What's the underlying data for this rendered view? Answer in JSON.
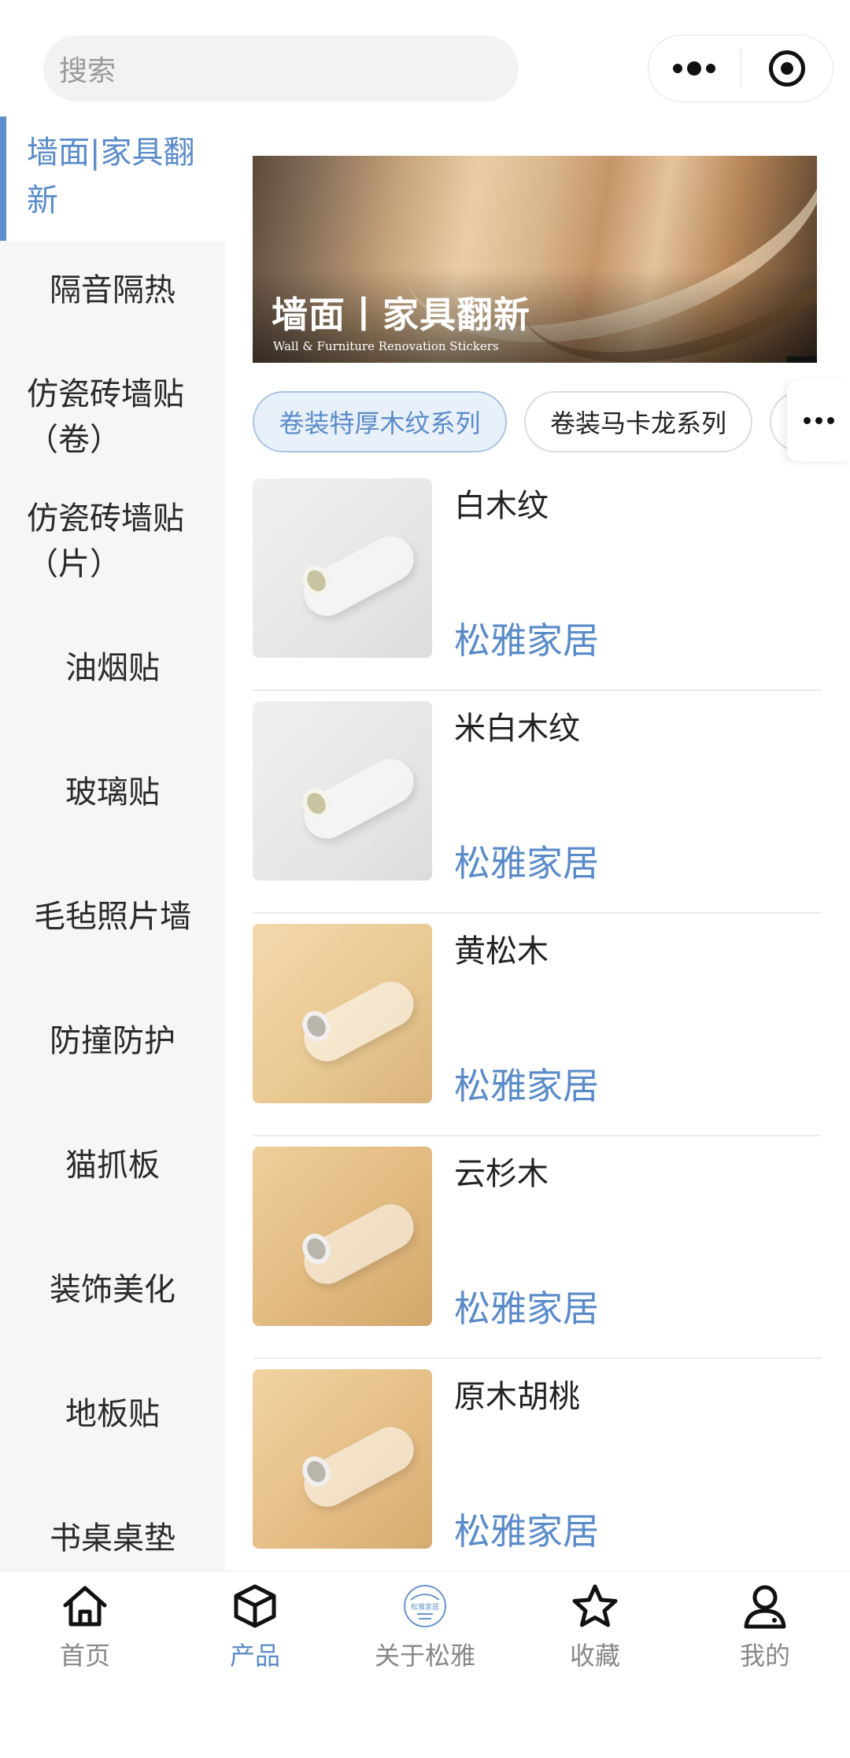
{
  "search": {
    "placeholder": "搜索"
  },
  "sidebar": {
    "active": "墙面|家具翻新",
    "items": [
      "隔音隔热",
      "仿瓷砖墙贴（卷）",
      "仿瓷砖墙贴（片）",
      "油烟贴",
      "玻璃贴",
      "毛毡照片墙",
      "防撞防护",
      "猫抓板",
      "装饰美化",
      "地板贴",
      "书桌桌垫"
    ]
  },
  "banner": {
    "title": "墙面丨家具翻新",
    "subtitle": "Wall & Furniture Renovation Stickers"
  },
  "chips": [
    "卷装特厚木纹系列",
    "卷装马卡龙系列"
  ],
  "products": [
    {
      "name": "白木纹",
      "brand": "松雅家居"
    },
    {
      "name": "米白木纹",
      "brand": "松雅家居"
    },
    {
      "name": "黄松木",
      "brand": "松雅家居"
    },
    {
      "name": "云杉木",
      "brand": "松雅家居"
    },
    {
      "name": "原木胡桃",
      "brand": "松雅家居"
    }
  ],
  "tabbar": {
    "items": [
      {
        "label": "首页",
        "icon": "home-icon"
      },
      {
        "label": "产品",
        "icon": "box-icon"
      },
      {
        "label": "关于松雅",
        "icon": "logo-icon",
        "logo_text": "松雅家居"
      },
      {
        "label": "收藏",
        "icon": "star-icon"
      },
      {
        "label": "我的",
        "icon": "user-icon"
      }
    ],
    "active_label": "产品"
  },
  "colors": {
    "accent": "#5a8bc9",
    "sidebar_bg": "#f6f6f6"
  }
}
